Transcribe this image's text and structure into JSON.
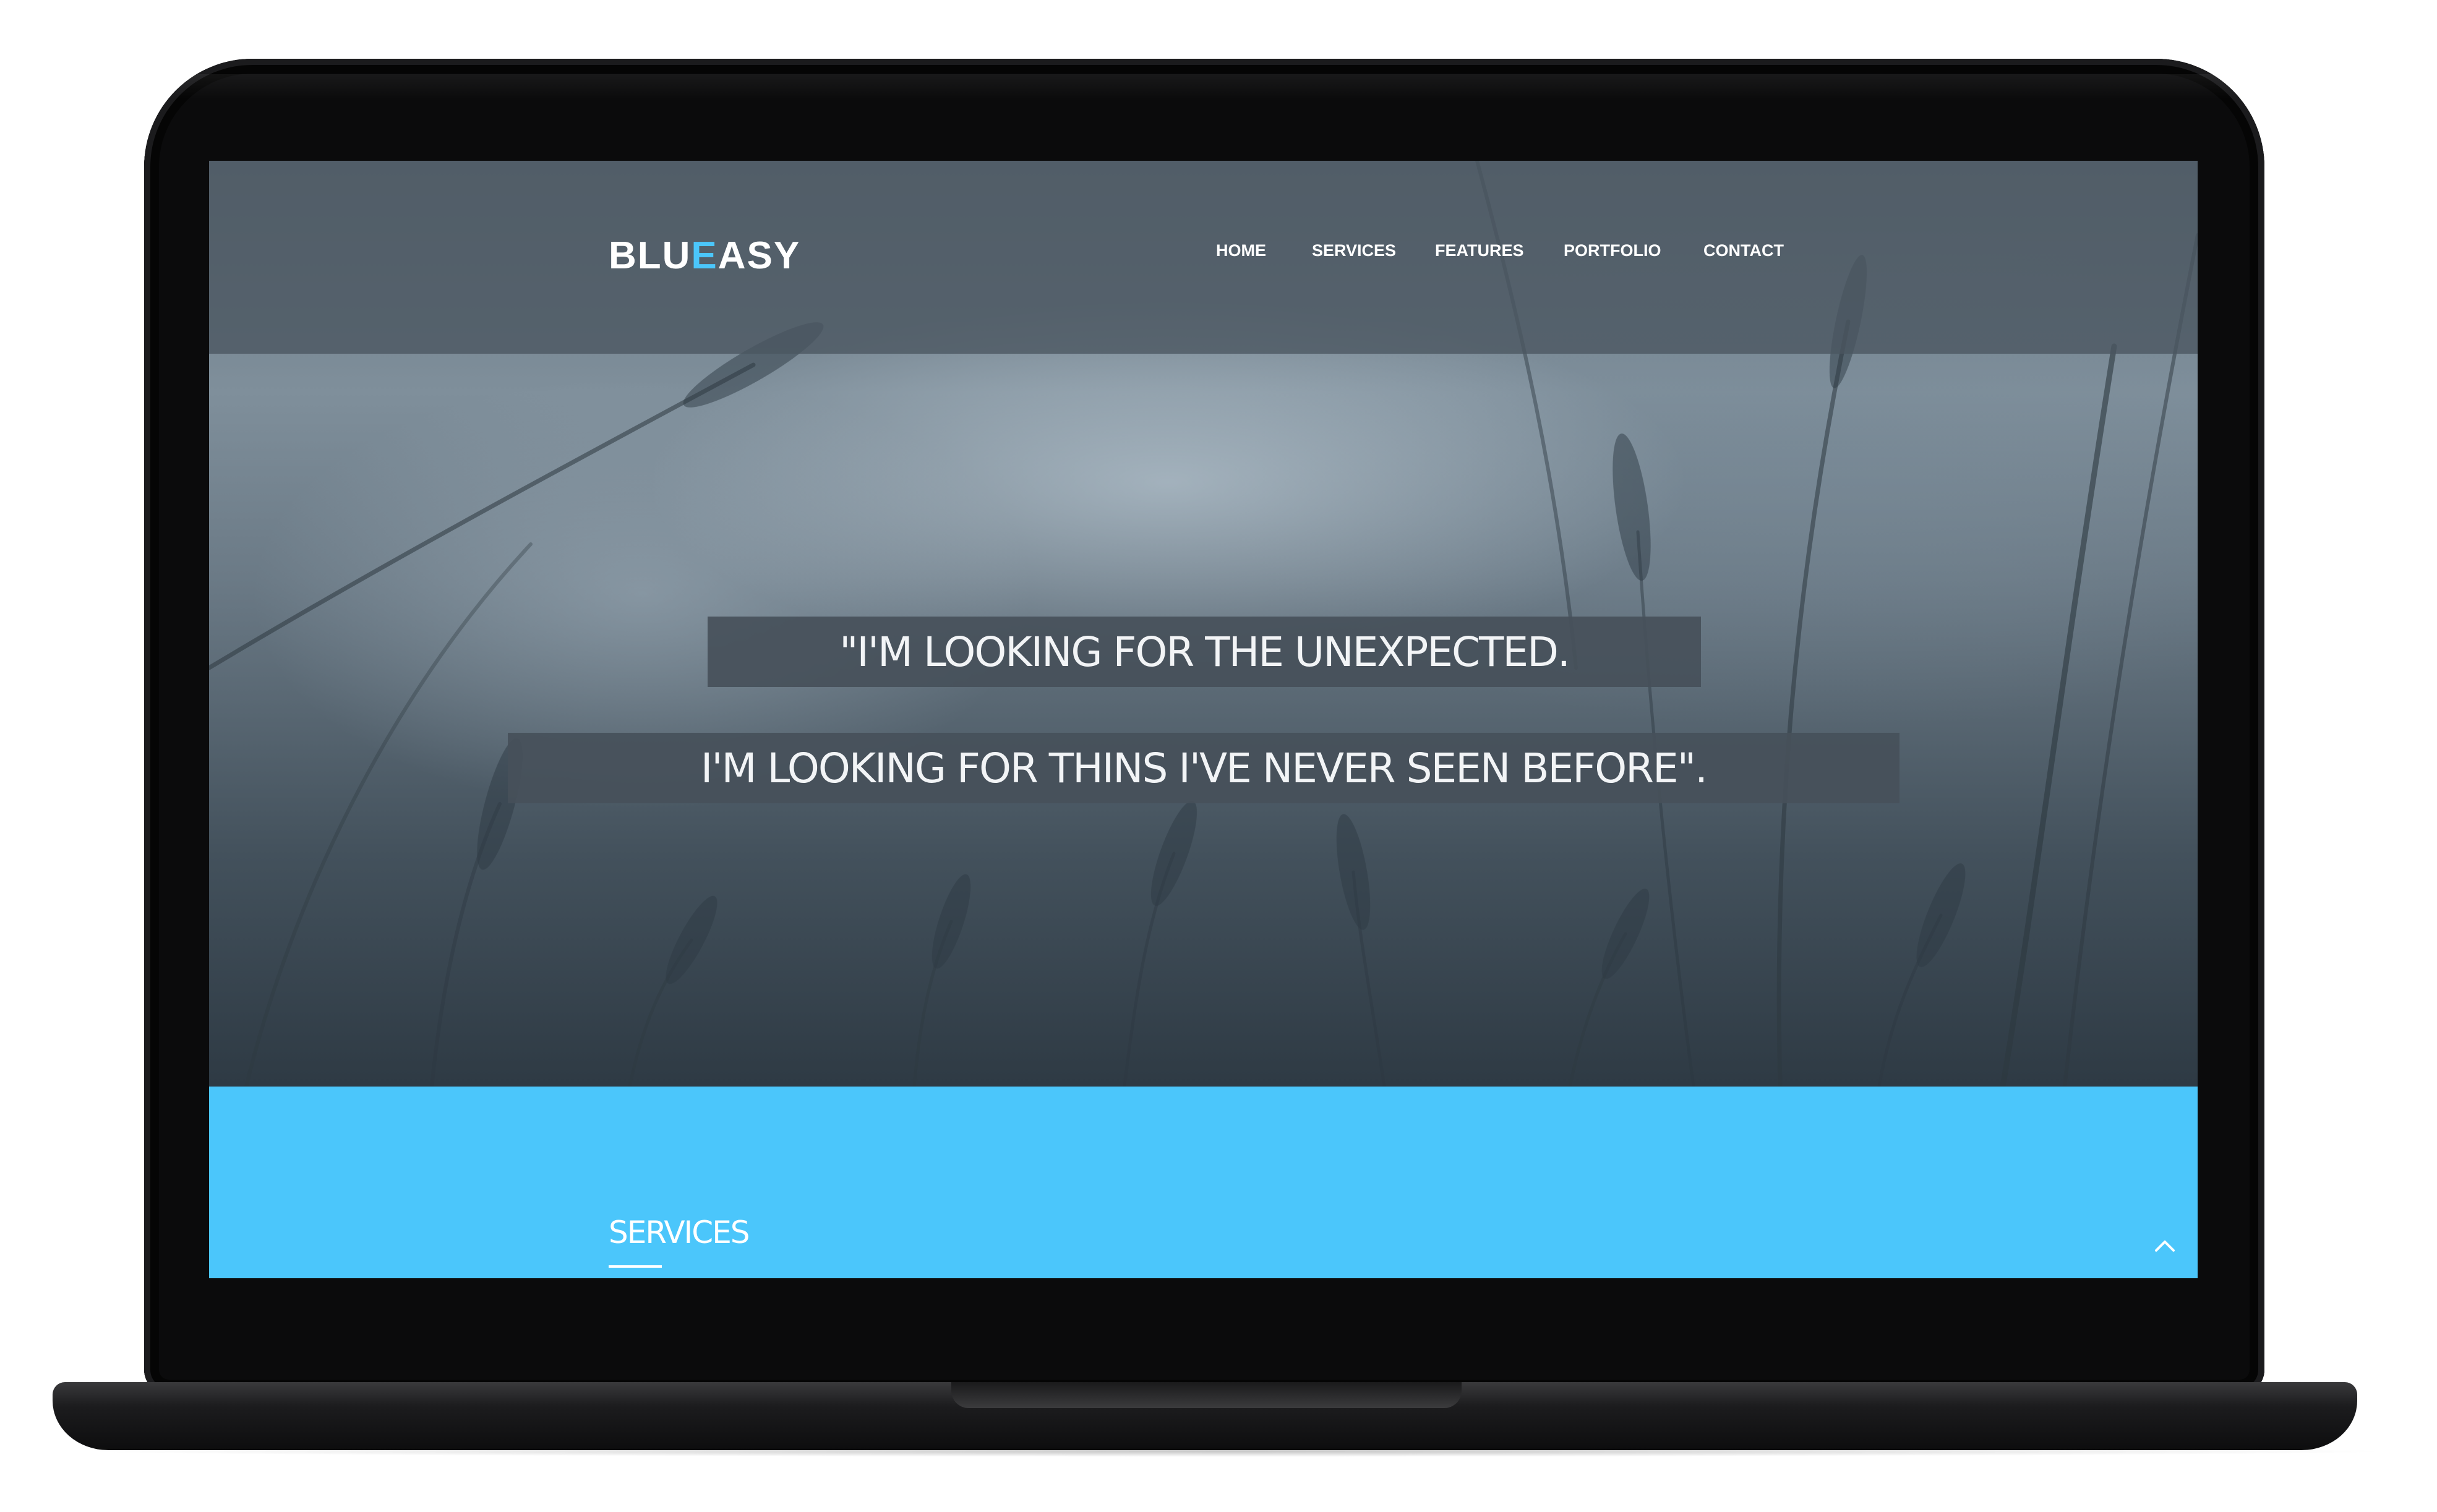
{
  "site": {
    "logo_part1": "BLU",
    "logo_accent": "E",
    "logo_part2": "ASY",
    "accent_color": "#4bc6fb"
  },
  "nav": {
    "items": [
      {
        "label": "HOME"
      },
      {
        "label": "SERVICES"
      },
      {
        "label": "FEATURES"
      },
      {
        "label": "PORTFOLIO"
      },
      {
        "label": "CONTACT"
      }
    ]
  },
  "hero": {
    "quote_line1": "\"I'M LOOKING FOR THE UNEXPECTED.",
    "quote_line2": "I'M LOOKING FOR THINS I'VE NEVER SEEN BEFORE\"."
  },
  "services": {
    "title": "SERVICES",
    "background_color": "#4bc6fb",
    "scroll_top_icon": "chevron-up-icon"
  }
}
